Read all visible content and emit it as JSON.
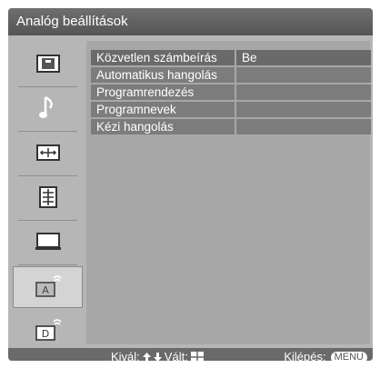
{
  "title": "Analóg beállítások",
  "sidebar": {
    "items": [
      {
        "name": "picture",
        "icon": "picture-icon"
      },
      {
        "name": "sound",
        "icon": "music-note-icon"
      },
      {
        "name": "screen",
        "icon": "screen-format-icon"
      },
      {
        "name": "features",
        "icon": "list-icon"
      },
      {
        "name": "setup",
        "icon": "monitor-icon"
      },
      {
        "name": "analog",
        "icon": "analog-antenna-icon",
        "selected": true
      },
      {
        "name": "digital",
        "icon": "digital-antenna-icon"
      }
    ]
  },
  "menu": {
    "rows": [
      {
        "label": "Közvetlen számbeírás",
        "value": "Be",
        "selected": true
      },
      {
        "label": "Automatikus hangolás",
        "value": ""
      },
      {
        "label": "Programrendezés",
        "value": ""
      },
      {
        "label": "Programnevek",
        "value": ""
      },
      {
        "label": "Kézi hangolás",
        "value": ""
      }
    ]
  },
  "footer": {
    "select_label": "Kivál:",
    "switch_label": "Vált:",
    "exit_label": "Kilépés:",
    "menu_button": "MENU"
  },
  "colors": {
    "background": "#b6b6b6",
    "title_bar": "#5e5e5e",
    "row": "#7c7c7c",
    "row_selected": "#6a6a6a"
  }
}
